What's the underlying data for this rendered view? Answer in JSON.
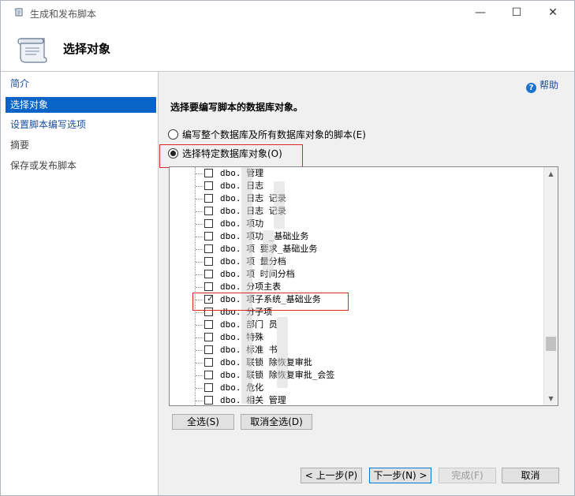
{
  "window": {
    "title": "生成和发布脚本",
    "minimize_icon": "minimize-icon",
    "maximize_icon": "maximize-icon",
    "close_icon": "close-icon",
    "minimize_glyph": "—",
    "maximize_glyph": "☐",
    "close_glyph": "✕"
  },
  "header": {
    "title": "选择对象",
    "icon": "script-scroll-icon"
  },
  "sidebar": {
    "items": [
      {
        "label": "简介",
        "state": "link"
      },
      {
        "label": "选择对象",
        "state": "selected"
      },
      {
        "label": "设置脚本编写选项",
        "state": "link"
      },
      {
        "label": "摘要",
        "state": "disabled"
      },
      {
        "label": "保存或发布脚本",
        "state": "disabled"
      }
    ]
  },
  "main": {
    "help_label": "帮助",
    "help_glyph": "?",
    "section_title": "选择要编写脚本的数据库对象。",
    "radio_all_label": "编写整个数据库及所有数据库对象的脚本(E)",
    "radio_specific_label": "选择特定数据库对象(O)",
    "selected_radio": "specific"
  },
  "tree": {
    "rows": [
      {
        "label": "dbo.  管理",
        "checked": false
      },
      {
        "label": "dbo.  日志",
        "checked": false
      },
      {
        "label": "dbo.  日志  记录",
        "checked": false
      },
      {
        "label": "dbo.  日志  记录",
        "checked": false
      },
      {
        "label": "dbo.  项功  ",
        "checked": false
      },
      {
        "label": "dbo.  项功  _基础业务",
        "checked": false
      },
      {
        "label": "dbo.  项  要求_基础业务",
        "checked": false
      },
      {
        "label": "dbo.  项  量分档",
        "checked": false
      },
      {
        "label": "dbo.  项  时间分档",
        "checked": false
      },
      {
        "label": "dbo.  分项主表",
        "checked": false
      },
      {
        "label": "dbo.  项子系统_基础业务",
        "checked": true
      },
      {
        "label": "dbo.  分子项",
        "checked": false
      },
      {
        "label": "dbo.  部门  员",
        "checked": false
      },
      {
        "label": "dbo.  特殊  ",
        "checked": false
      },
      {
        "label": "dbo.  标准  书",
        "checked": false
      },
      {
        "label": "dbo.  联锁  除恢复审批",
        "checked": false
      },
      {
        "label": "dbo.  联锁  除恢复审批_会签",
        "checked": false
      },
      {
        "label": "dbo.  危化",
        "checked": false
      },
      {
        "label": "dbo.  相关  管理",
        "checked": false
      }
    ],
    "scroll_up_glyph": "▲",
    "scroll_down_glyph": "▼",
    "check_glyph": "✓"
  },
  "buttons": {
    "select_all": "全选(S)",
    "deselect_all": "取消全选(D)",
    "prev": "< 上一步(P)",
    "next": "下一步(N) >",
    "finish": "完成(F)",
    "cancel": "取消"
  }
}
